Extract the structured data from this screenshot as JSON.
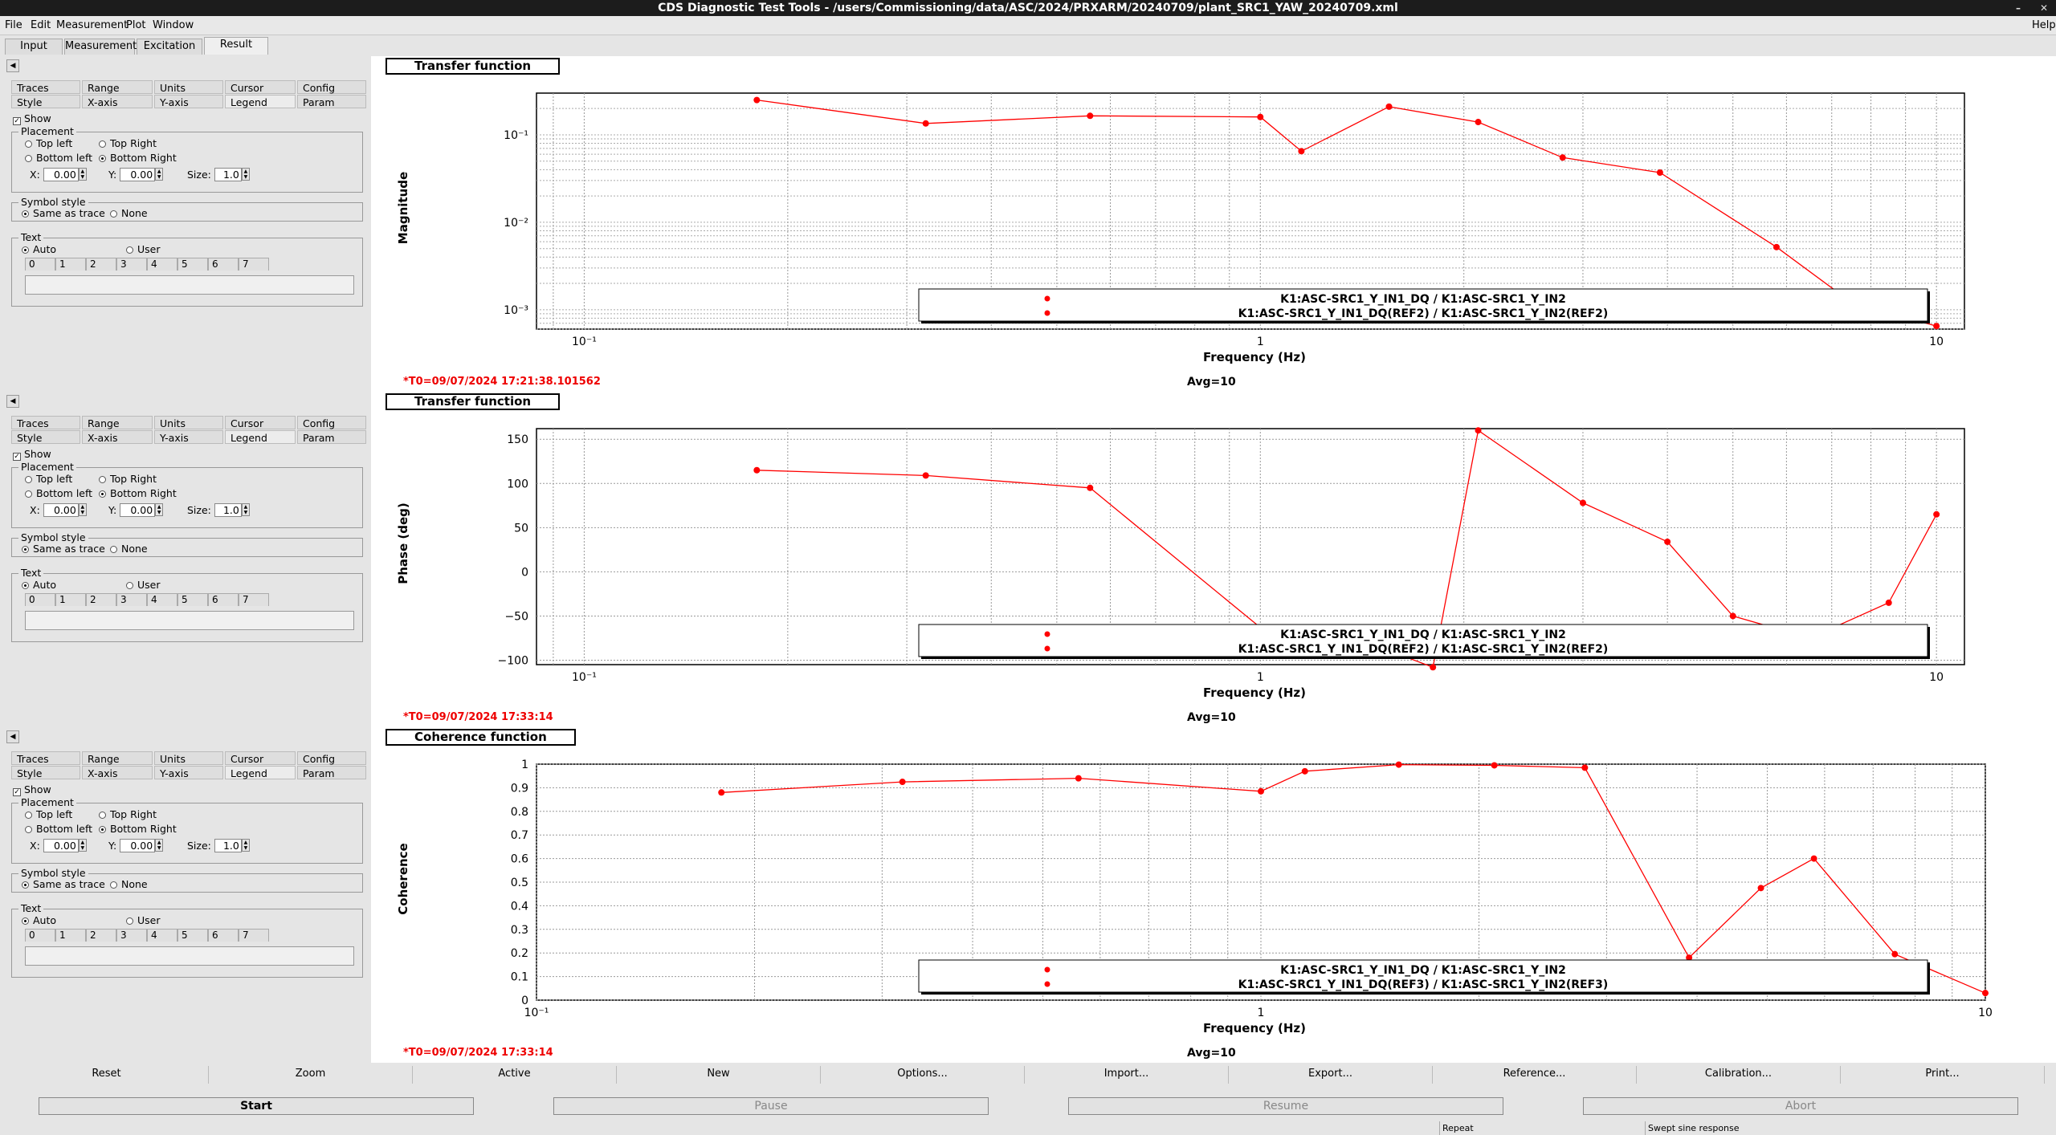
{
  "window": {
    "title": "CDS Diagnostic Test Tools - /users/Commissioning/data/ASC/2024/PRXARM/20240709/plant_SRC1_YAW_20240709.xml"
  },
  "menu": {
    "file": "File",
    "edit": "Edit",
    "measurement": "Measurement",
    "plot": "Plot",
    "window": "Window",
    "help": "Help"
  },
  "main_tabs": [
    "Input",
    "Measurement",
    "Excitation",
    "Result"
  ],
  "side": {
    "tabs_row1": [
      "Traces",
      "Range",
      "Units",
      "Cursor",
      "Config"
    ],
    "tabs_row2": [
      "Style",
      "X-axis",
      "Y-axis",
      "Legend",
      "Param"
    ],
    "show": "Show",
    "placement": "Placement",
    "top_left": "Top left",
    "top_right": "Top Right",
    "bottom_left": "Bottom left",
    "bottom_right": "Bottom Right",
    "x_label": "X:",
    "y_label": "Y:",
    "size_label": "Size:",
    "x_value": "0.00",
    "y_value": "0.00",
    "size_value": "1.0",
    "symbol_style": "Symbol style",
    "same_as_trace": "Same as trace",
    "none": "None",
    "text": "Text",
    "auto": "Auto",
    "user": "User",
    "text_tabs": [
      "0",
      "1",
      "2",
      "3",
      "4",
      "5",
      "6",
      "7"
    ]
  },
  "plots": [
    {
      "title": "Transfer function",
      "ylabel": "Magnitude",
      "xlabel": "Frequency (Hz)",
      "t0": "*T0=09/07/2024 17:21:38.101562",
      "avg": "Avg=10",
      "legend": [
        "K1:ASC-SRC1_Y_IN1_DQ / K1:ASC-SRC1_Y_IN2",
        "K1:ASC-SRC1_Y_IN1_DQ(REF2) / K1:ASC-SRC1_Y_IN2(REF2)"
      ],
      "x_ticks": [
        "10⁻¹",
        "1",
        "10"
      ],
      "y_ticks": [
        "10⁻¹",
        "10⁻²",
        "10⁻³"
      ]
    },
    {
      "title": "Transfer function",
      "ylabel": "Phase (deg)",
      "xlabel": "Frequency (Hz)",
      "t0": "*T0=09/07/2024 17:33:14",
      "avg": "Avg=10",
      "legend": [
        "K1:ASC-SRC1_Y_IN1_DQ / K1:ASC-SRC1_Y_IN2",
        "K1:ASC-SRC1_Y_IN1_DQ(REF2) / K1:ASC-SRC1_Y_IN2(REF2)"
      ],
      "x_ticks": [
        "10⁻¹",
        "1",
        "10"
      ],
      "y_ticks": [
        "150",
        "100",
        "50",
        "0",
        "−50",
        "−100"
      ]
    },
    {
      "title": "Coherence function",
      "ylabel": "Coherence",
      "xlabel": "Frequency (Hz)",
      "t0": "*T0=09/07/2024 17:33:14",
      "avg": "Avg=10",
      "legend": [
        "K1:ASC-SRC1_Y_IN1_DQ / K1:ASC-SRC1_Y_IN2",
        "K1:ASC-SRC1_Y_IN1_DQ(REF3) / K1:ASC-SRC1_Y_IN2(REF3)"
      ],
      "x_ticks": [
        "10⁻¹",
        "1",
        "10"
      ],
      "y_ticks": [
        "1",
        "0.9",
        "0.8",
        "0.7",
        "0.6",
        "0.5",
        "0.4",
        "0.3",
        "0.2",
        "0.1",
        "0"
      ]
    }
  ],
  "chart_data": [
    {
      "type": "line",
      "title": "Transfer function",
      "xlabel": "Frequency (Hz)",
      "ylabel": "Magnitude",
      "xscale": "log",
      "yscale": "log",
      "xlim": [
        0.085,
        11
      ],
      "ylim": [
        0.0006,
        0.3
      ],
      "grid": true,
      "legend_position": "bottom-right",
      "series": [
        {
          "name": "K1:ASC-SRC1_Y_IN1_DQ / K1:ASC-SRC1_Y_IN2",
          "x": [
            0.18,
            0.32,
            0.56,
            1.0,
            1.15,
            1.55,
            2.1,
            2.8,
            3.9,
            5.8,
            7.5,
            10.0
          ],
          "y": [
            0.25,
            0.135,
            0.165,
            0.16,
            0.065,
            0.21,
            0.14,
            0.055,
            0.037,
            0.0052,
            0.0012,
            0.00065
          ]
        }
      ],
      "color": "#ff0000"
    },
    {
      "type": "line",
      "title": "Transfer function",
      "xlabel": "Frequency (Hz)",
      "ylabel": "Phase (deg)",
      "xscale": "log",
      "xlim": [
        0.085,
        11
      ],
      "ylim": [
        -105,
        162
      ],
      "grid": true,
      "legend_position": "bottom-right",
      "series": [
        {
          "name": "K1:ASC-SRC1_Y_IN1_DQ / K1:ASC-SRC1_Y_IN2",
          "x": [
            0.18,
            0.32,
            0.56,
            1.0,
            1.5,
            1.8,
            2.1,
            3.0,
            4.0,
            5.0,
            6.5,
            8.5,
            10.0
          ],
          "y": [
            115,
            109,
            95,
            -63,
            -85,
            -108,
            160,
            78,
            34,
            -50,
            -75,
            -35,
            65
          ]
        }
      ],
      "color": "#ff0000"
    },
    {
      "type": "line",
      "title": "Coherence function",
      "xlabel": "Frequency (Hz)",
      "ylabel": "Coherence",
      "xscale": "log",
      "xlim": [
        0.1,
        10
      ],
      "ylim": [
        0,
        1
      ],
      "grid": true,
      "legend_position": "bottom-right",
      "series": [
        {
          "name": "K1:ASC-SRC1_Y_IN1_DQ / K1:ASC-SRC1_Y_IN2",
          "x": [
            0.18,
            0.32,
            0.56,
            1.0,
            1.15,
            1.55,
            2.1,
            2.8,
            3.9,
            4.9,
            5.8,
            7.5,
            10.0
          ],
          "y": [
            0.88,
            0.925,
            0.94,
            0.885,
            0.97,
            0.998,
            0.995,
            0.985,
            0.18,
            0.475,
            0.6,
            0.195,
            0.03
          ]
        }
      ],
      "color": "#ff0000"
    }
  ],
  "bottom_buttons": [
    "Reset",
    "Zoom",
    "Active",
    "New",
    "Options...",
    "Import...",
    "Export...",
    "Reference...",
    "Calibration...",
    "Print..."
  ],
  "run_buttons": [
    "Start",
    "Pause",
    "Resume",
    "Abort"
  ],
  "status": {
    "repeat": "Repeat",
    "mode": "Swept sine response"
  }
}
